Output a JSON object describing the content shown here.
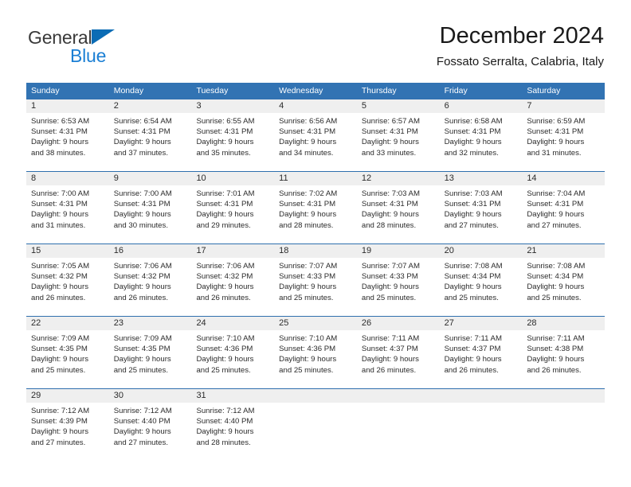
{
  "brand": {
    "name_part1": "General",
    "name_part2": "Blue",
    "triangle_icon": "triangle-icon",
    "colors": {
      "general_text": "#3a3a3a",
      "blue_text": "#1b7fd4",
      "triangle": "#0b6cb5"
    }
  },
  "header": {
    "title": "December 2024",
    "subtitle": "Fossato Serralta, Calabria, Italy"
  },
  "theme": {
    "header_row_bg": "#3273b3",
    "header_row_text": "#ffffff",
    "daynum_band_bg": "#efefef",
    "week_rule": "#2f6fae",
    "cell_text": "#2b2b2b"
  },
  "weekdays": [
    "Sunday",
    "Monday",
    "Tuesday",
    "Wednesday",
    "Thursday",
    "Friday",
    "Saturday"
  ],
  "weeks": [
    {
      "days": [
        {
          "day": "1",
          "sunrise": "Sunrise: 6:53 AM",
          "sunset": "Sunset: 4:31 PM",
          "daylight_line1": "Daylight: 9 hours",
          "daylight_line2": "and 38 minutes."
        },
        {
          "day": "2",
          "sunrise": "Sunrise: 6:54 AM",
          "sunset": "Sunset: 4:31 PM",
          "daylight_line1": "Daylight: 9 hours",
          "daylight_line2": "and 37 minutes."
        },
        {
          "day": "3",
          "sunrise": "Sunrise: 6:55 AM",
          "sunset": "Sunset: 4:31 PM",
          "daylight_line1": "Daylight: 9 hours",
          "daylight_line2": "and 35 minutes."
        },
        {
          "day": "4",
          "sunrise": "Sunrise: 6:56 AM",
          "sunset": "Sunset: 4:31 PM",
          "daylight_line1": "Daylight: 9 hours",
          "daylight_line2": "and 34 minutes."
        },
        {
          "day": "5",
          "sunrise": "Sunrise: 6:57 AM",
          "sunset": "Sunset: 4:31 PM",
          "daylight_line1": "Daylight: 9 hours",
          "daylight_line2": "and 33 minutes."
        },
        {
          "day": "6",
          "sunrise": "Sunrise: 6:58 AM",
          "sunset": "Sunset: 4:31 PM",
          "daylight_line1": "Daylight: 9 hours",
          "daylight_line2": "and 32 minutes."
        },
        {
          "day": "7",
          "sunrise": "Sunrise: 6:59 AM",
          "sunset": "Sunset: 4:31 PM",
          "daylight_line1": "Daylight: 9 hours",
          "daylight_line2": "and 31 minutes."
        }
      ]
    },
    {
      "days": [
        {
          "day": "8",
          "sunrise": "Sunrise: 7:00 AM",
          "sunset": "Sunset: 4:31 PM",
          "daylight_line1": "Daylight: 9 hours",
          "daylight_line2": "and 31 minutes."
        },
        {
          "day": "9",
          "sunrise": "Sunrise: 7:00 AM",
          "sunset": "Sunset: 4:31 PM",
          "daylight_line1": "Daylight: 9 hours",
          "daylight_line2": "and 30 minutes."
        },
        {
          "day": "10",
          "sunrise": "Sunrise: 7:01 AM",
          "sunset": "Sunset: 4:31 PM",
          "daylight_line1": "Daylight: 9 hours",
          "daylight_line2": "and 29 minutes."
        },
        {
          "day": "11",
          "sunrise": "Sunrise: 7:02 AM",
          "sunset": "Sunset: 4:31 PM",
          "daylight_line1": "Daylight: 9 hours",
          "daylight_line2": "and 28 minutes."
        },
        {
          "day": "12",
          "sunrise": "Sunrise: 7:03 AM",
          "sunset": "Sunset: 4:31 PM",
          "daylight_line1": "Daylight: 9 hours",
          "daylight_line2": "and 28 minutes."
        },
        {
          "day": "13",
          "sunrise": "Sunrise: 7:03 AM",
          "sunset": "Sunset: 4:31 PM",
          "daylight_line1": "Daylight: 9 hours",
          "daylight_line2": "and 27 minutes."
        },
        {
          "day": "14",
          "sunrise": "Sunrise: 7:04 AM",
          "sunset": "Sunset: 4:31 PM",
          "daylight_line1": "Daylight: 9 hours",
          "daylight_line2": "and 27 minutes."
        }
      ]
    },
    {
      "days": [
        {
          "day": "15",
          "sunrise": "Sunrise: 7:05 AM",
          "sunset": "Sunset: 4:32 PM",
          "daylight_line1": "Daylight: 9 hours",
          "daylight_line2": "and 26 minutes."
        },
        {
          "day": "16",
          "sunrise": "Sunrise: 7:06 AM",
          "sunset": "Sunset: 4:32 PM",
          "daylight_line1": "Daylight: 9 hours",
          "daylight_line2": "and 26 minutes."
        },
        {
          "day": "17",
          "sunrise": "Sunrise: 7:06 AM",
          "sunset": "Sunset: 4:32 PM",
          "daylight_line1": "Daylight: 9 hours",
          "daylight_line2": "and 26 minutes."
        },
        {
          "day": "18",
          "sunrise": "Sunrise: 7:07 AM",
          "sunset": "Sunset: 4:33 PM",
          "daylight_line1": "Daylight: 9 hours",
          "daylight_line2": "and 25 minutes."
        },
        {
          "day": "19",
          "sunrise": "Sunrise: 7:07 AM",
          "sunset": "Sunset: 4:33 PM",
          "daylight_line1": "Daylight: 9 hours",
          "daylight_line2": "and 25 minutes."
        },
        {
          "day": "20",
          "sunrise": "Sunrise: 7:08 AM",
          "sunset": "Sunset: 4:34 PM",
          "daylight_line1": "Daylight: 9 hours",
          "daylight_line2": "and 25 minutes."
        },
        {
          "day": "21",
          "sunrise": "Sunrise: 7:08 AM",
          "sunset": "Sunset: 4:34 PM",
          "daylight_line1": "Daylight: 9 hours",
          "daylight_line2": "and 25 minutes."
        }
      ]
    },
    {
      "days": [
        {
          "day": "22",
          "sunrise": "Sunrise: 7:09 AM",
          "sunset": "Sunset: 4:35 PM",
          "daylight_line1": "Daylight: 9 hours",
          "daylight_line2": "and 25 minutes."
        },
        {
          "day": "23",
          "sunrise": "Sunrise: 7:09 AM",
          "sunset": "Sunset: 4:35 PM",
          "daylight_line1": "Daylight: 9 hours",
          "daylight_line2": "and 25 minutes."
        },
        {
          "day": "24",
          "sunrise": "Sunrise: 7:10 AM",
          "sunset": "Sunset: 4:36 PM",
          "daylight_line1": "Daylight: 9 hours",
          "daylight_line2": "and 25 minutes."
        },
        {
          "day": "25",
          "sunrise": "Sunrise: 7:10 AM",
          "sunset": "Sunset: 4:36 PM",
          "daylight_line1": "Daylight: 9 hours",
          "daylight_line2": "and 25 minutes."
        },
        {
          "day": "26",
          "sunrise": "Sunrise: 7:11 AM",
          "sunset": "Sunset: 4:37 PM",
          "daylight_line1": "Daylight: 9 hours",
          "daylight_line2": "and 26 minutes."
        },
        {
          "day": "27",
          "sunrise": "Sunrise: 7:11 AM",
          "sunset": "Sunset: 4:37 PM",
          "daylight_line1": "Daylight: 9 hours",
          "daylight_line2": "and 26 minutes."
        },
        {
          "day": "28",
          "sunrise": "Sunrise: 7:11 AM",
          "sunset": "Sunset: 4:38 PM",
          "daylight_line1": "Daylight: 9 hours",
          "daylight_line2": "and 26 minutes."
        }
      ]
    },
    {
      "days": [
        {
          "day": "29",
          "sunrise": "Sunrise: 7:12 AM",
          "sunset": "Sunset: 4:39 PM",
          "daylight_line1": "Daylight: 9 hours",
          "daylight_line2": "and 27 minutes."
        },
        {
          "day": "30",
          "sunrise": "Sunrise: 7:12 AM",
          "sunset": "Sunset: 4:40 PM",
          "daylight_line1": "Daylight: 9 hours",
          "daylight_line2": "and 27 minutes."
        },
        {
          "day": "31",
          "sunrise": "Sunrise: 7:12 AM",
          "sunset": "Sunset: 4:40 PM",
          "daylight_line1": "Daylight: 9 hours",
          "daylight_line2": "and 28 minutes."
        },
        {
          "day": "",
          "sunrise": "",
          "sunset": "",
          "daylight_line1": "",
          "daylight_line2": ""
        },
        {
          "day": "",
          "sunrise": "",
          "sunset": "",
          "daylight_line1": "",
          "daylight_line2": ""
        },
        {
          "day": "",
          "sunrise": "",
          "sunset": "",
          "daylight_line1": "",
          "daylight_line2": ""
        },
        {
          "day": "",
          "sunrise": "",
          "sunset": "",
          "daylight_line1": "",
          "daylight_line2": ""
        }
      ]
    }
  ]
}
